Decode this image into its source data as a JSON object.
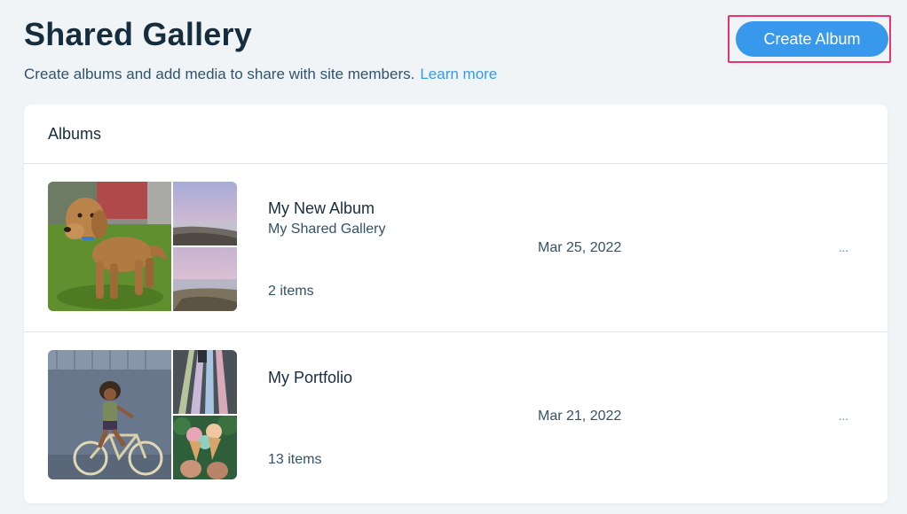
{
  "header": {
    "title": "Shared Gallery",
    "subtitle": "Create albums and add media to share with site members.",
    "learn_more": "Learn more",
    "create_button": "Create Album"
  },
  "albums_card": {
    "heading": "Albums",
    "albums": [
      {
        "name": "My New Album",
        "gallery": "My Shared Gallery",
        "date": "Mar 25, 2022",
        "count": "2 items",
        "more_label": "···"
      },
      {
        "name": "My Portfolio",
        "gallery": "",
        "date": "Mar 21, 2022",
        "count": "13 items",
        "more_label": "···"
      }
    ]
  },
  "colors": {
    "accent": "#3899ec",
    "highlight": "#e8336b",
    "text_primary": "#162d3d",
    "background": "#f0f4f7"
  }
}
